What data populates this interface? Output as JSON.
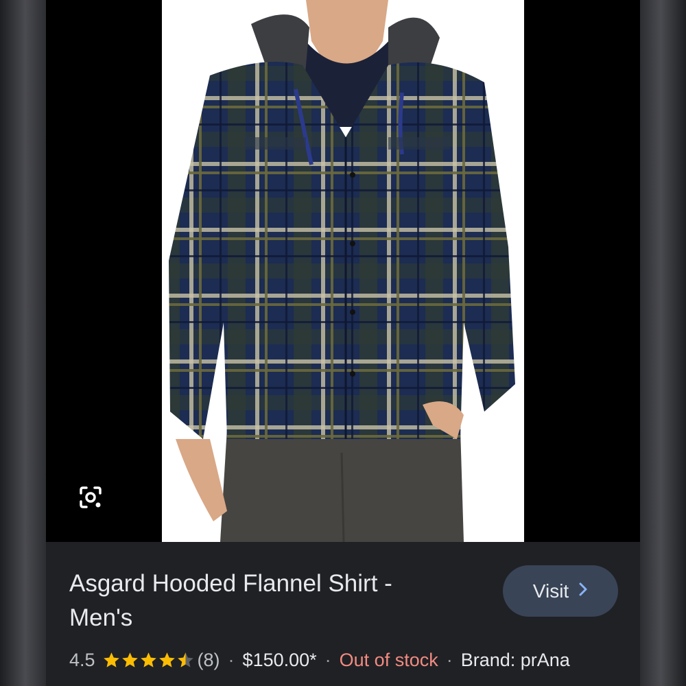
{
  "product": {
    "title": "Asgard Hooded Flannel Shirt - Men's",
    "rating": "4.5",
    "stars_value": 4.5,
    "stars_max": 5,
    "reviews": "(8)",
    "price": "$150.00*",
    "stock_status": "Out of stock",
    "brand": "Brand: prAna",
    "separator": "·"
  },
  "actions": {
    "visit_label": "Visit"
  },
  "icons": {
    "lens": "google-lens-icon",
    "visit_chevron": "chevron-right-icon",
    "star": "star-icon"
  },
  "colors": {
    "star": "#fbbc04",
    "out_of_stock": "#f28b82",
    "visit_chevron": "#8ab4f8",
    "visit_button_bg": "#394457"
  }
}
